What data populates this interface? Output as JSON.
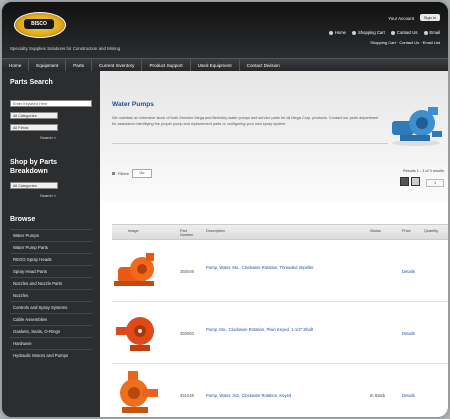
{
  "header": {
    "logo_text": "BISCO",
    "tagline": "Specialty Supplies Solutions for Construction and Mining",
    "account_label": "Your Account",
    "signin_label": "Sign In",
    "links": [
      {
        "icon": "home-icon",
        "label": "Home"
      },
      {
        "icon": "cart-icon",
        "label": "Shopping Cart"
      },
      {
        "icon": "phone-icon",
        "label": "Contact Us"
      },
      {
        "icon": "email-icon",
        "label": "Email"
      }
    ],
    "hours": "Shopping Cart · Contact Us · Email List"
  },
  "nav": {
    "items": [
      "Home",
      "Equipment",
      "Parts",
      "Current Inventory",
      "Product Support",
      "Used Equipment",
      "Contact Division"
    ]
  },
  "sidebar": {
    "parts_search_title": "Parts Search",
    "keyword_placeholder": "Enter Keyword Here",
    "category_select": "All Categories",
    "fields_select": "All Fields",
    "search_label": "Search »",
    "shop_title_line1": "Shop by Parts",
    "shop_title_line2": "Breakdown",
    "breakdown_select": "All Categories",
    "browse_title": "Browse",
    "browse_items": [
      "Water Pumps",
      "Water Pump Parts",
      "REGO Spray Heads",
      "Spray Head Parts",
      "Nozzles and Nozzle Parts",
      "Nozzles",
      "Controls and Spray Systems",
      "Cable Assemblies",
      "Gaskets, Seals, O-Rings",
      "Hardware",
      "Hydraulic Motors and Pumps"
    ]
  },
  "main": {
    "title": "Water Pumps",
    "description": "We maintain an extensive stock of both Genuine Mega and Berkeley water pumps and service parts for all Mega Corp. products. Contact our parts department for assistance identifying the proper pump and replacement parts or configuring your own spray system.",
    "filter_label": "Filters",
    "filter_button": "Go",
    "pager_text": "Results 1 - 3 of 3 results",
    "page_value": "1",
    "columns": [
      "Image",
      "Part Number",
      "Description",
      "Status",
      "Price",
      "Quantity"
    ],
    "rows": [
      {
        "part_number": "350046",
        "description": "Pump, Water, Mo., Clockwise Rotation, Threaded Impeller",
        "status": "",
        "price": "Details",
        "color": "#e85a14"
      },
      {
        "part_number": "350063",
        "description": "Pump, Mo., Clockwise Rotation, Plain Keyed, 1-1/2\" Shaft",
        "status": "",
        "price": "Details",
        "color": "#e04a18"
      },
      {
        "part_number": "351048",
        "description": "Pump, Water, 3x2, Clockwise Rotation, Keyed",
        "status": "In Stock",
        "price": "Details",
        "color": "#e8641a"
      }
    ]
  },
  "colors": {
    "link": "#1f4e9a",
    "sidebar": "#2b2d2f",
    "pump_orange": "#e85a14"
  }
}
